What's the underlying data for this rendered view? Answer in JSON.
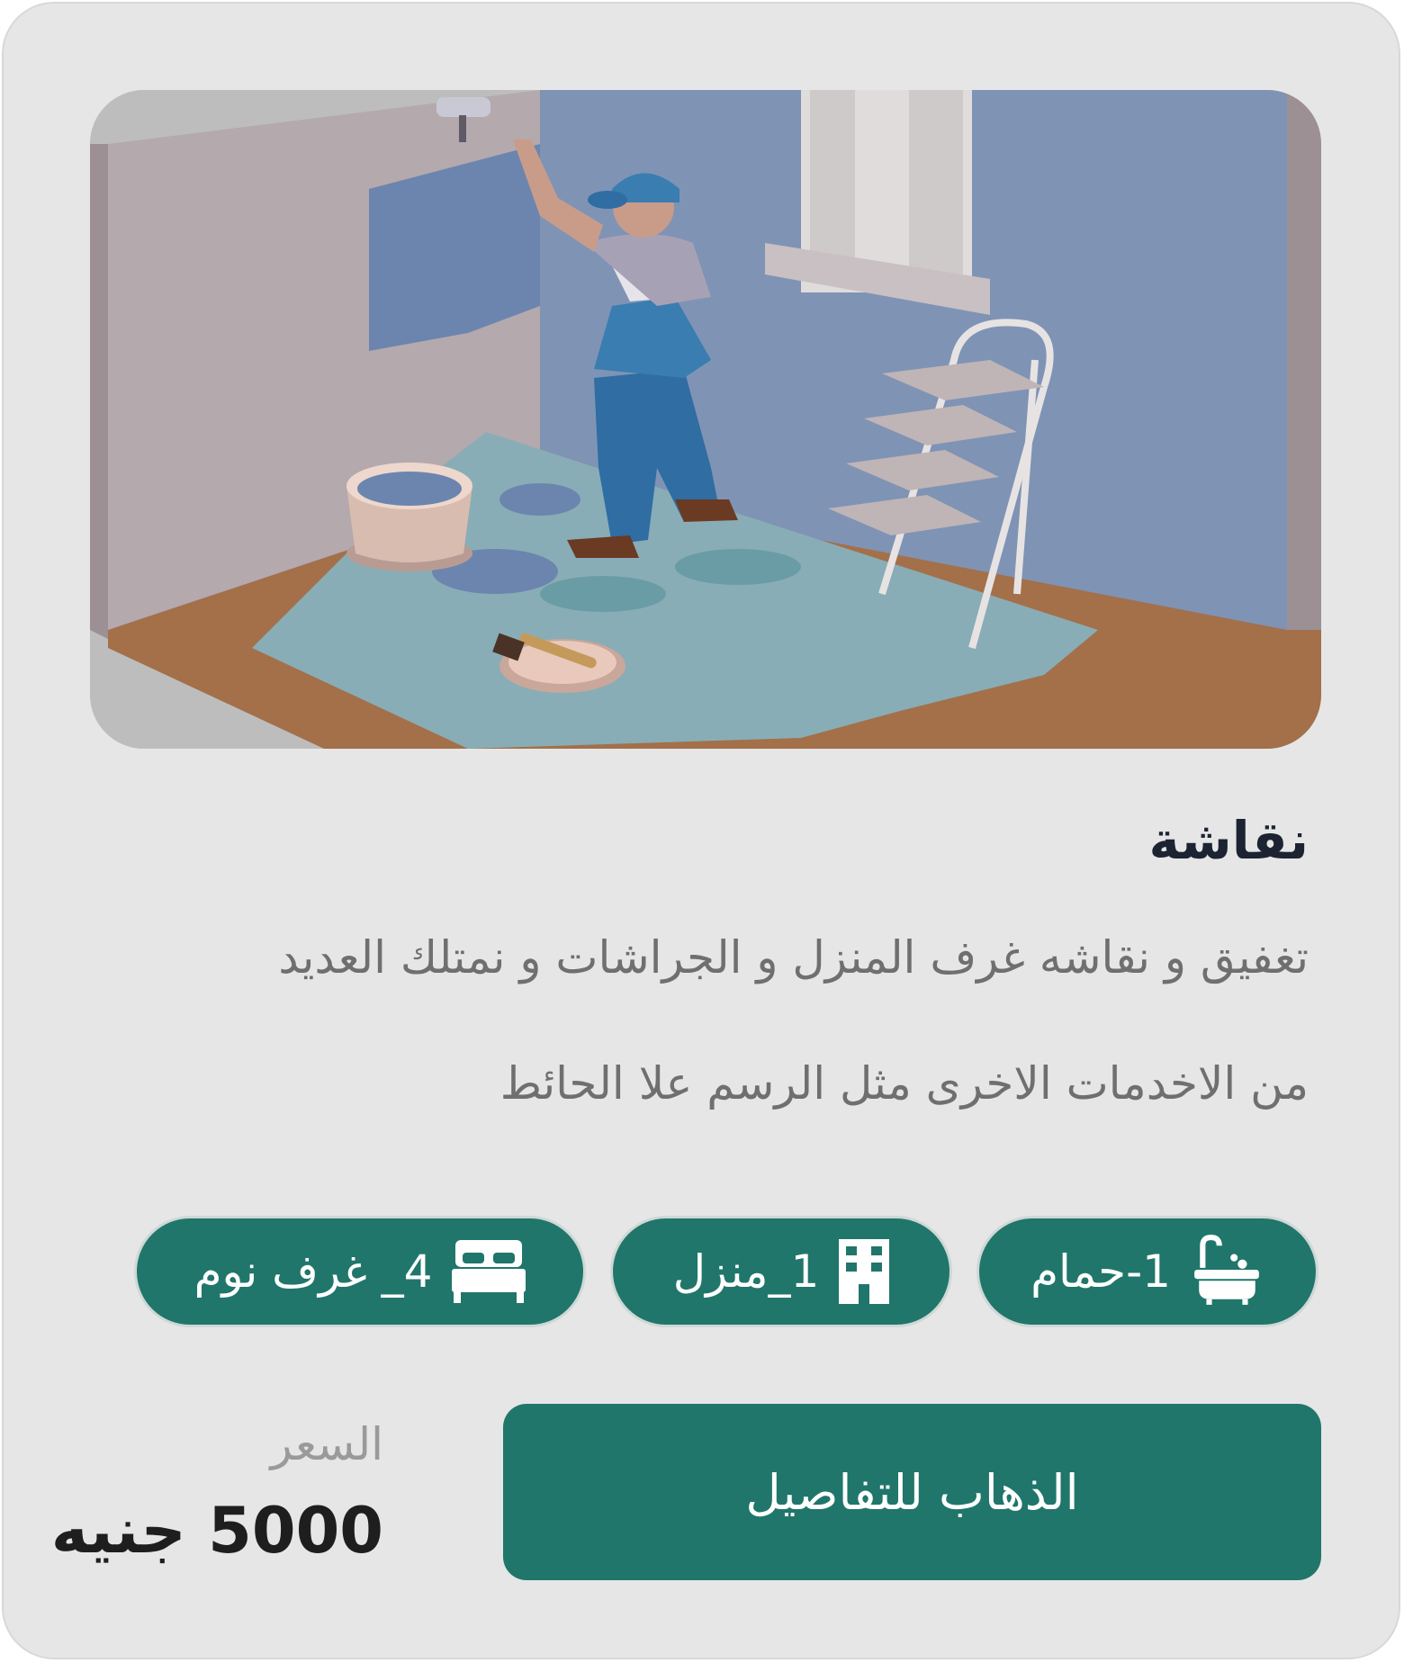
{
  "service": {
    "title": "نقاشة",
    "description_lines": [
      "تغفيق و نقاشه غرف المنزل و الجراشات و نمتلك العديد",
      "من الاخدمات الاخرى مثل الرسم علا الحائط"
    ],
    "image_alt": "painter-illustration"
  },
  "features": {
    "bathroom": {
      "label": "1-حمام",
      "icon": "bathtub-icon"
    },
    "house": {
      "label": "1_منزل",
      "icon": "building-icon"
    },
    "bedrooms": {
      "label": "4_ غرف نوم",
      "icon": "bed-icon"
    }
  },
  "action": {
    "details_label": "الذهاب للتفاصيل"
  },
  "price": {
    "label": "السعر",
    "value": "5000 جنيه"
  },
  "colors": {
    "accent": "#20766a",
    "card_bg": "#e6e6e6",
    "title": "#1c2433",
    "muted": "#6f6f6f"
  }
}
